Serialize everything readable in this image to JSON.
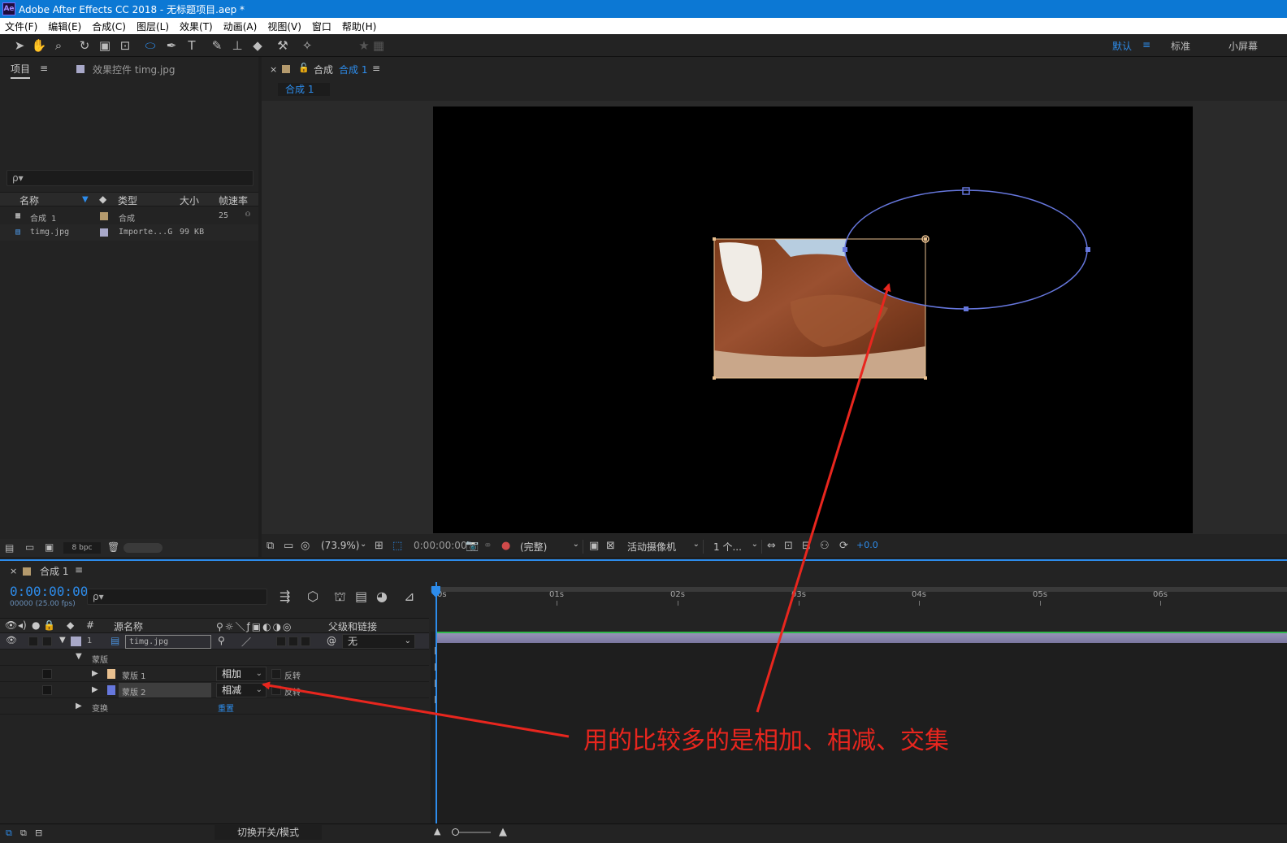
{
  "window": {
    "title": "Adobe After Effects CC 2018 - 无标题项目.aep *",
    "app_icon": "Ae"
  },
  "menu": [
    "文件(F)",
    "编辑(E)",
    "合成(C)",
    "图层(L)",
    "效果(T)",
    "动画(A)",
    "视图(V)",
    "窗口",
    "帮助(H)"
  ],
  "workspaces": {
    "default": "默认",
    "standard": "标准",
    "small": "小屏幕"
  },
  "project_panel": {
    "tab_project": "项目",
    "tab_effects": "效果控件 timg.jpg",
    "search_placeholder": "ρ▾",
    "columns": {
      "name": "名称",
      "type": "类型",
      "size": "大小",
      "fps": "帧速率"
    },
    "items": [
      {
        "name": "合成 1",
        "type": "合成",
        "size": "",
        "fps": "25",
        "label_color": "#b49a6d"
      },
      {
        "name": "timg.jpg",
        "type": "Importe...G",
        "size": "99 KB",
        "fps": "",
        "label_color": "#a8a8c8"
      }
    ],
    "bpc": "8 bpc"
  },
  "viewer": {
    "tab_prefix": "合成",
    "tab_name": "合成 1",
    "subtab": "合成 1",
    "zoom": "(73.9%)",
    "time": "0:00:00:00",
    "resolution": "(完整)",
    "camera": "活动摄像机",
    "views": "1 个...",
    "exposure": "+0.0"
  },
  "timeline": {
    "tab": "合成 1",
    "timecode": "0:00:00:00",
    "timecode_sub": "00000 (25.00 fps)",
    "search_placeholder": "ρ▾",
    "headers": {
      "num": "#",
      "source": "源名称",
      "parent": "父级和链接"
    },
    "layer": {
      "index": "1",
      "name": "timg.jpg",
      "parent": "无"
    },
    "masks_group": "蒙版",
    "masks": [
      {
        "name": "蒙版 1",
        "mode": "相加",
        "invert": "反转",
        "color": "#e9c08f"
      },
      {
        "name": "蒙版 2",
        "mode": "相减",
        "invert": "反转",
        "color": "#6677dd"
      }
    ],
    "transform": {
      "label": "变换",
      "reset": "重置"
    },
    "ruler": [
      "0s",
      "01s",
      "02s",
      "03s",
      "04s",
      "05s",
      "06s"
    ],
    "bottom_label": "切换开关/模式"
  },
  "annotation": {
    "text": "用的比较多的是相加、相减、交集",
    "color": "#e8261e"
  }
}
